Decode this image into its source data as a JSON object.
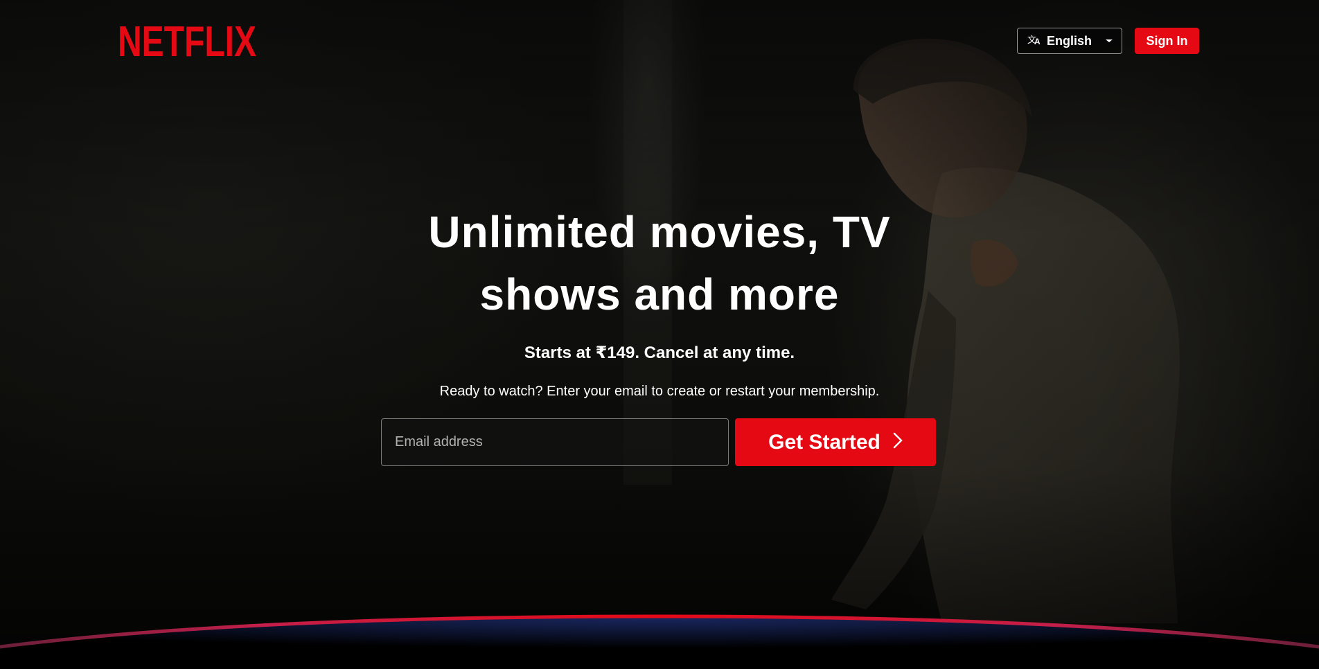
{
  "brand": {
    "name": "NETFLIX",
    "color": "#e50914"
  },
  "header": {
    "language_label": "English",
    "language_icon": "translate-icon",
    "dropdown_icon": "caret-down-icon",
    "signin_label": "Sign In"
  },
  "hero": {
    "title": "Unlimited movies, TV shows and more",
    "subtitle": "Starts at ₹149. Cancel at any time.",
    "cta_text": "Ready to watch? Enter your email to create or restart your membership.",
    "email_placeholder": "Email address",
    "get_started_label": "Get Started",
    "get_started_icon": "chevron-right-icon"
  }
}
